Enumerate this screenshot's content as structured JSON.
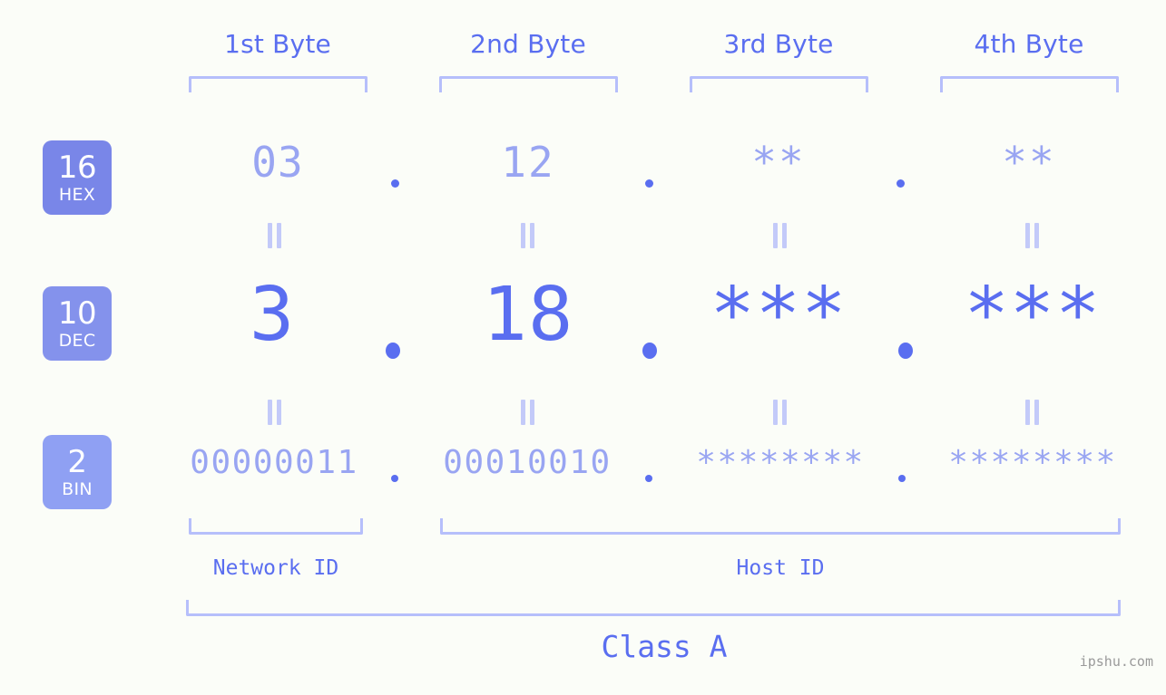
{
  "meta": {
    "background": "#fbfdf8",
    "accent": "#5a6ef0",
    "accent_light": "#99a5f2",
    "bracket": "#b6bffb",
    "eq_color": "#c3caf9"
  },
  "byte_headers": [
    {
      "label": "1st Byte"
    },
    {
      "label": "2nd Byte"
    },
    {
      "label": "3rd Byte"
    },
    {
      "label": "4th Byte"
    }
  ],
  "rows": [
    {
      "badge": {
        "number": "16",
        "name": "HEX",
        "color": "#7986e8"
      },
      "values": [
        "03",
        "12",
        "**",
        "**"
      ],
      "separator": "."
    },
    {
      "badge": {
        "number": "10",
        "name": "DEC",
        "color": "#8492ec"
      },
      "values": [
        "3",
        "18",
        "***",
        "***"
      ],
      "separator": "."
    },
    {
      "badge": {
        "number": "2",
        "name": "BIN",
        "color": "#8fa0f3"
      },
      "values": [
        "00000011",
        "00010010",
        "********",
        "********"
      ],
      "separator": "."
    }
  ],
  "segments": {
    "network_id": "Network ID",
    "host_id": "Host ID"
  },
  "class": {
    "label": "Class A"
  },
  "watermark": {
    "text": "ipshu.com"
  }
}
